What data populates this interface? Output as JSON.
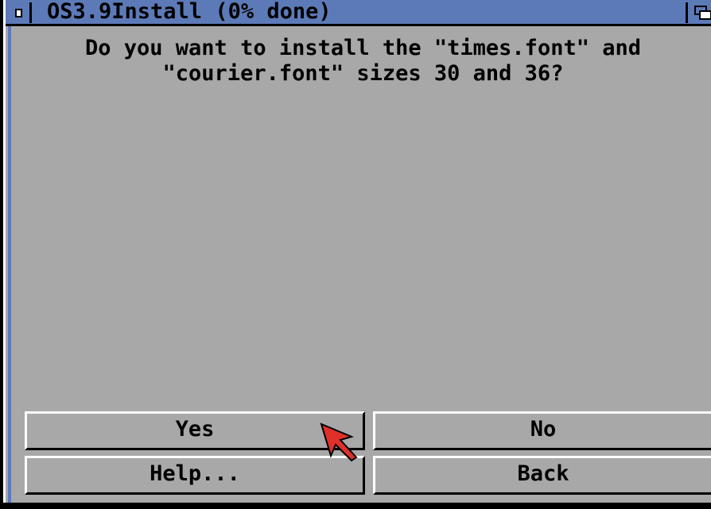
{
  "window": {
    "title": "OS3.9Install (0% done)"
  },
  "dialog": {
    "question_line1": "Do you want to install the \"times.font\" and",
    "question_line2": "\"courier.font\" sizes 30 and 36?"
  },
  "buttons": {
    "yes": "Yes",
    "no": "No",
    "help": "Help...",
    "back": "Back"
  },
  "colors": {
    "titlebar": "#5d7ab8",
    "background": "#a8a8a8",
    "pointer": "#e0302a"
  },
  "icons": {
    "close": "close-gadget-icon",
    "depth": "depth-gadget-icon",
    "pointer": "mouse-pointer-icon"
  }
}
